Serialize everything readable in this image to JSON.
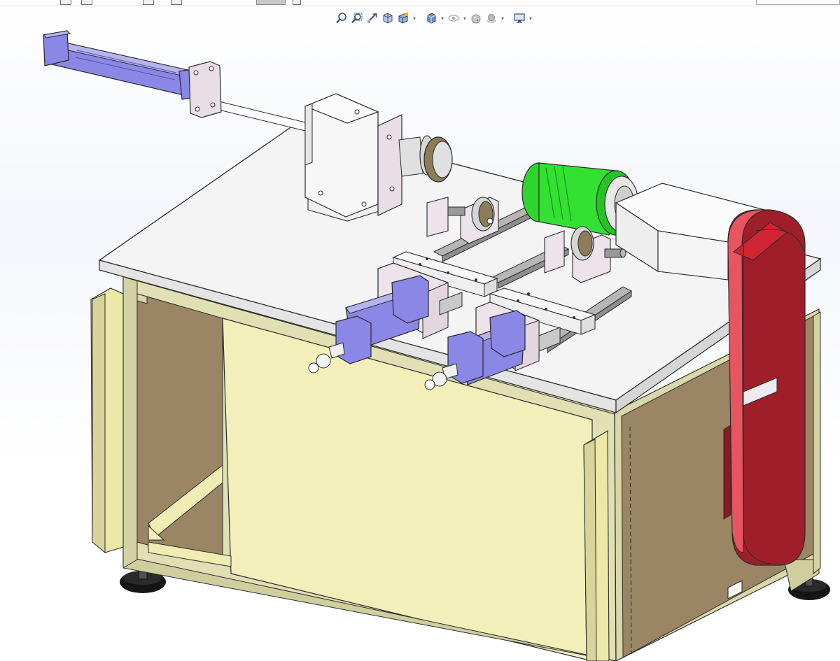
{
  "window": {
    "kind": "cad-graphics-area",
    "background_top": "#ffffff",
    "background_mid": "#f4f6fb"
  },
  "heads_up_toolbar": {
    "items": [
      {
        "name": "zoom-to-fit-icon",
        "has_dropdown": false
      },
      {
        "name": "zoom-to-area-icon",
        "has_dropdown": false
      },
      {
        "name": "previous-view-icon",
        "has_dropdown": false
      },
      {
        "name": "section-view-icon",
        "has_dropdown": false
      },
      {
        "name": "view-orientation-icon",
        "has_dropdown": true
      },
      {
        "name": "display-style-icon",
        "has_dropdown": true
      },
      {
        "name": "hide-show-items-icon",
        "has_dropdown": true
      },
      {
        "name": "edit-appearance-icon",
        "has_dropdown": false
      },
      {
        "name": "apply-scene-icon",
        "has_dropdown": true
      },
      {
        "name": "view-settings-icon",
        "has_dropdown": true
      }
    ]
  },
  "model": {
    "description_colors": {
      "frame": "#d8d8a8",
      "panel": "#f1eeb9",
      "side_panel": "#9c8562",
      "tabletop": "#f6f6f6",
      "cylinder": "#8a87e6",
      "green_part": "#2ee02e",
      "belt_guard": "#e0252c",
      "bracket": "#e8dee6",
      "foot": "#1a1a1a"
    }
  }
}
